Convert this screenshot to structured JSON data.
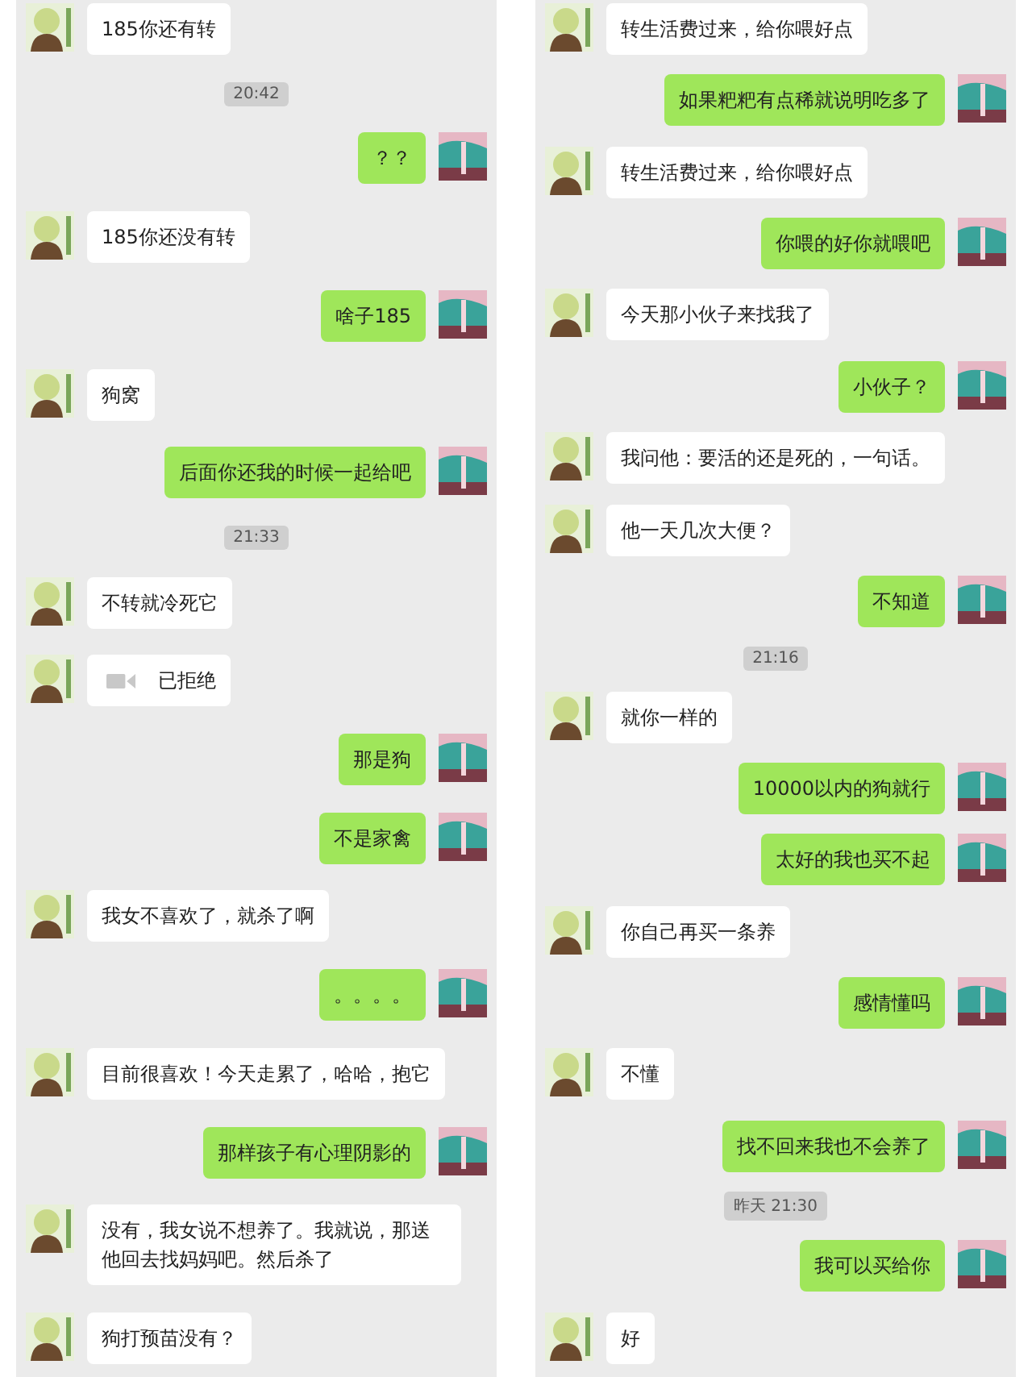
{
  "panels": [
    {
      "messages": [
        {
          "kind": "received",
          "text": "185你还有转"
        },
        {
          "kind": "time",
          "text": "20:42"
        },
        {
          "kind": "sent",
          "text": "？？"
        },
        {
          "kind": "received",
          "text": "185你还没有转"
        },
        {
          "kind": "sent",
          "text": "啥子185"
        },
        {
          "kind": "received",
          "text": "狗窝"
        },
        {
          "kind": "sent",
          "text": "后面你还我的时候一起给吧"
        },
        {
          "kind": "time",
          "text": "21:33"
        },
        {
          "kind": "received",
          "text": "不转就冷死它"
        },
        {
          "kind": "call",
          "text": "已拒绝"
        },
        {
          "kind": "sent",
          "text": "那是狗"
        },
        {
          "kind": "sent",
          "text": "不是家禽"
        },
        {
          "kind": "received",
          "text": "我女不喜欢了，就杀了啊"
        },
        {
          "kind": "sent",
          "text": "。。。。"
        },
        {
          "kind": "received",
          "text": "目前很喜欢！今天走累了，哈哈，抱它"
        },
        {
          "kind": "sent",
          "text": "那样孩子有心理阴影的"
        },
        {
          "kind": "received",
          "text": "没有，我女说不想养了。我就说，那送他回去找妈妈吧。然后杀了"
        },
        {
          "kind": "received",
          "text": "狗打预苗没有？"
        }
      ]
    },
    {
      "messages": [
        {
          "kind": "received",
          "text": "转生活费过来，给你喂好点"
        },
        {
          "kind": "sent",
          "text": "如果粑粑有点稀就说明吃多了"
        },
        {
          "kind": "received",
          "text": "转生活费过来，给你喂好点"
        },
        {
          "kind": "sent",
          "text": "你喂的好你就喂吧"
        },
        {
          "kind": "received",
          "text": "今天那小伙子来找我了"
        },
        {
          "kind": "sent",
          "text": "小伙子？"
        },
        {
          "kind": "received",
          "text": "我问他：要活的还是死的，一句话。"
        },
        {
          "kind": "received",
          "text": "他一天几次大便？"
        },
        {
          "kind": "sent",
          "text": "不知道"
        },
        {
          "kind": "time",
          "text": "21:16"
        },
        {
          "kind": "received",
          "text": "就你一样的"
        },
        {
          "kind": "sent",
          "text": "10000以内的狗就行"
        },
        {
          "kind": "sent",
          "text": "太好的我也买不起"
        },
        {
          "kind": "received",
          "text": "你自己再买一条养"
        },
        {
          "kind": "sent",
          "text": "感情懂吗"
        },
        {
          "kind": "received",
          "text": "不懂"
        },
        {
          "kind": "sent",
          "text": "找不回来我也不会养了"
        },
        {
          "kind": "time",
          "text": "昨天 21:30"
        },
        {
          "kind": "sent",
          "text": "我可以买给你"
        },
        {
          "kind": "received",
          "text": "好"
        }
      ]
    }
  ]
}
